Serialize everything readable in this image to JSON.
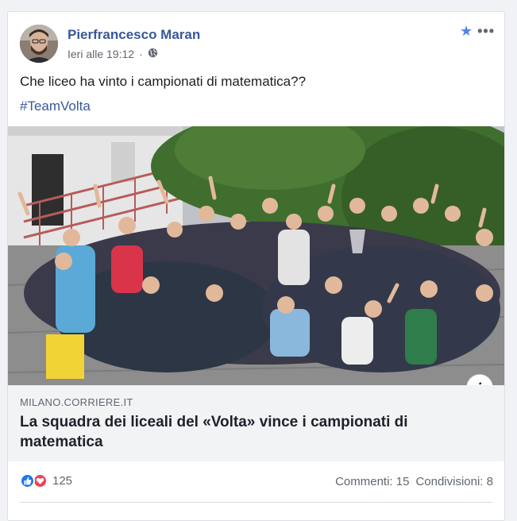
{
  "post": {
    "author": "Pierfrancesco Maran",
    "timestamp": "Ieri alle 19:12",
    "text": "Che liceo ha vinto i campionati di matematica??",
    "hashtag": "#TeamVolta"
  },
  "link": {
    "domain": "MILANO.CORRIERE.IT",
    "title": "La squadra dei liceali del «Volta» vince i campionati di matematica"
  },
  "stats": {
    "reactions_count": "125",
    "comments": "Commenti: 15",
    "shares": "Condivisioni: 8"
  },
  "icons": {
    "privacy": "globe-icon",
    "favorite": "star-icon",
    "more": "more-options-icon",
    "info": "info-icon",
    "like": "like-reaction-icon",
    "love": "love-reaction-icon"
  },
  "colors": {
    "link_blue": "#385898",
    "like_blue": "#1877f2",
    "love_red": "#f33e58",
    "star_blue": "#4d88e6"
  }
}
